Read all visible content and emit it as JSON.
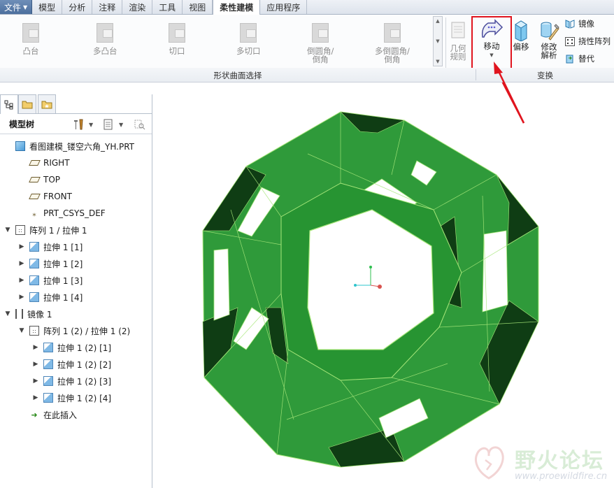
{
  "tabs": [
    {
      "label": "文件",
      "type": "file"
    },
    {
      "label": "模型"
    },
    {
      "label": "分析"
    },
    {
      "label": "注释"
    },
    {
      "label": "渲染"
    },
    {
      "label": "工具"
    },
    {
      "label": "视图"
    },
    {
      "label": "柔性建模",
      "active": true
    },
    {
      "label": "应用程序"
    }
  ],
  "ribbon": {
    "shape_buttons": [
      {
        "label": "凸台"
      },
      {
        "label": "多凸台"
      },
      {
        "label": "切口"
      },
      {
        "label": "多切口"
      },
      {
        "label": "倒圆角/\n倒角"
      },
      {
        "label": "多倒圆角/\n倒角"
      }
    ],
    "geometry_rules_label": "几何\n规则",
    "move_label": "移动",
    "offset_label": "偏移",
    "modify_label": "修改\n解析",
    "mirror_label": "镜像",
    "flex_pattern_label": "挠性阵列",
    "substitute_label": "替代",
    "group_shape_label": "形状曲面选择",
    "group_transform_label": "变换"
  },
  "navigator": {
    "title": "模型树"
  },
  "tree": [
    {
      "label": "看图建模_镂空六角_YH.PRT",
      "icon": "part-icon",
      "indent": 0,
      "twisty": ""
    },
    {
      "label": "RIGHT",
      "icon": "datum-plane-icon",
      "indent": 1,
      "twisty": ""
    },
    {
      "label": "TOP",
      "icon": "datum-plane-icon",
      "indent": 1,
      "twisty": ""
    },
    {
      "label": "FRONT",
      "icon": "datum-plane-icon",
      "indent": 1,
      "twisty": ""
    },
    {
      "label": "PRT_CSYS_DEF",
      "icon": "csys-icon",
      "indent": 1,
      "twisty": ""
    },
    {
      "label": "阵列 1 / 拉伸 1",
      "icon": "pattern-icon",
      "indent": 0,
      "twisty": "▼"
    },
    {
      "label": "拉伸 1 [1]",
      "icon": "extrude-icon",
      "indent": 1,
      "twisty": "▶"
    },
    {
      "label": "拉伸 1 [2]",
      "icon": "extrude-icon",
      "indent": 1,
      "twisty": "▶"
    },
    {
      "label": "拉伸 1 [3]",
      "icon": "extrude-icon",
      "indent": 1,
      "twisty": "▶"
    },
    {
      "label": "拉伸 1 [4]",
      "icon": "extrude-icon",
      "indent": 1,
      "twisty": "▶"
    },
    {
      "label": "镜像 1",
      "icon": "mirror-icon",
      "indent": 0,
      "twisty": "▼"
    },
    {
      "label": "阵列 1 (2) / 拉伸 1 (2)",
      "icon": "pattern-icon",
      "indent": 1,
      "twisty": "▼"
    },
    {
      "label": "拉伸 1 (2) [1]",
      "icon": "extrude-icon",
      "indent": 2,
      "twisty": "▶"
    },
    {
      "label": "拉伸 1 (2) [2]",
      "icon": "extrude-icon",
      "indent": 2,
      "twisty": "▶"
    },
    {
      "label": "拉伸 1 (2) [3]",
      "icon": "extrude-icon",
      "indent": 2,
      "twisty": "▶"
    },
    {
      "label": "拉伸 1 (2) [4]",
      "icon": "extrude-icon",
      "indent": 2,
      "twisty": "▶"
    },
    {
      "label": "在此插入",
      "icon": "insert-here-icon",
      "indent": 1,
      "twisty": ""
    }
  ],
  "watermark": {
    "title": "野火论坛",
    "url": "www.proewildfire.cn"
  },
  "colors": {
    "model_green": "#2f9a3a",
    "model_dark": "#0f3d14",
    "highlight_red": "#e0141e"
  }
}
